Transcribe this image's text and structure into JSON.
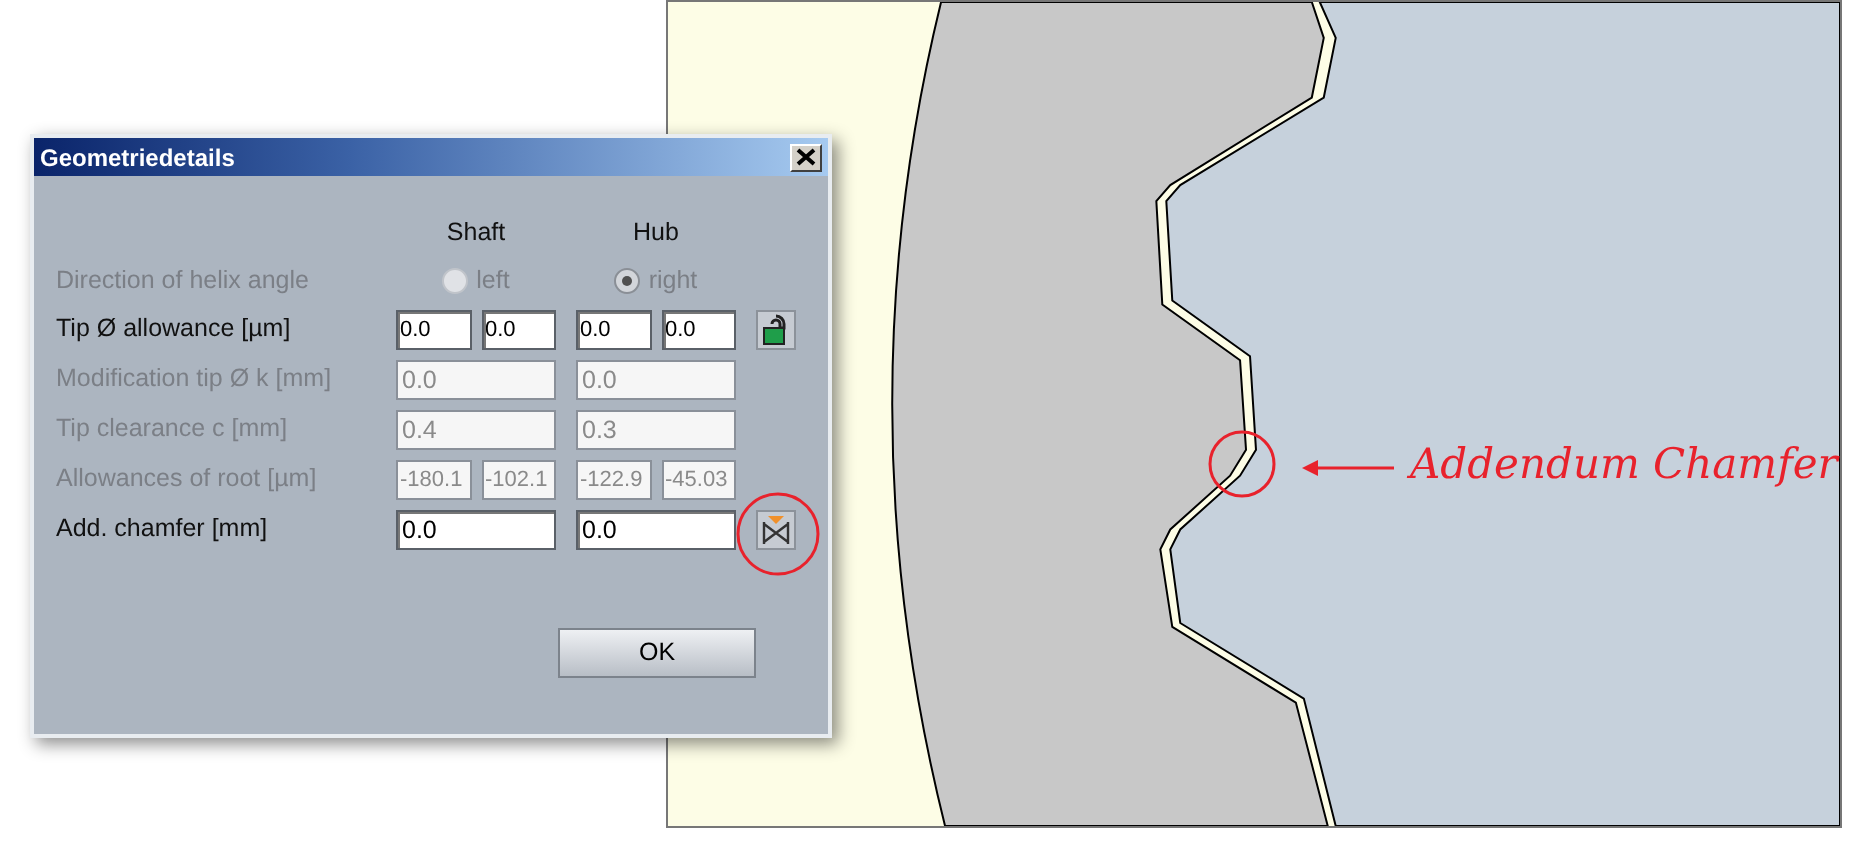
{
  "dialog": {
    "title": "Geometriedetails",
    "columns": [
      "Shaft",
      "Hub"
    ],
    "rows": [
      {
        "kind": "radio",
        "label": "Direction of helix angle",
        "disabled": true,
        "options": [
          {
            "label": "left",
            "selected": false
          },
          {
            "label": "right",
            "selected": true
          }
        ]
      },
      {
        "kind": "split",
        "label": "Tip Ø allowance [µm]",
        "disabled": false,
        "values": [
          "0.0",
          "0.0",
          "0.0",
          "0.0"
        ],
        "button": {
          "kind": "lock"
        }
      },
      {
        "kind": "single",
        "label": "Modification tip Ø k [mm]",
        "disabled": true,
        "values": [
          "0.0",
          "0.0"
        ]
      },
      {
        "kind": "single",
        "label": "Tip clearance c [mm]",
        "disabled": true,
        "values": [
          "0.4",
          "0.3"
        ]
      },
      {
        "kind": "split",
        "label": "Allowances of root [µm]",
        "disabled": true,
        "values": [
          "-180.1",
          "-102.1",
          "-122.9",
          "-45.03"
        ]
      },
      {
        "kind": "single",
        "label": "Add. chamfer [mm]",
        "disabled": false,
        "values": [
          "0.0",
          "0.0"
        ],
        "button": {
          "kind": "chamfer"
        }
      }
    ],
    "ok_button": "OK"
  },
  "annotation": {
    "label": "Addendum Chamfer"
  }
}
